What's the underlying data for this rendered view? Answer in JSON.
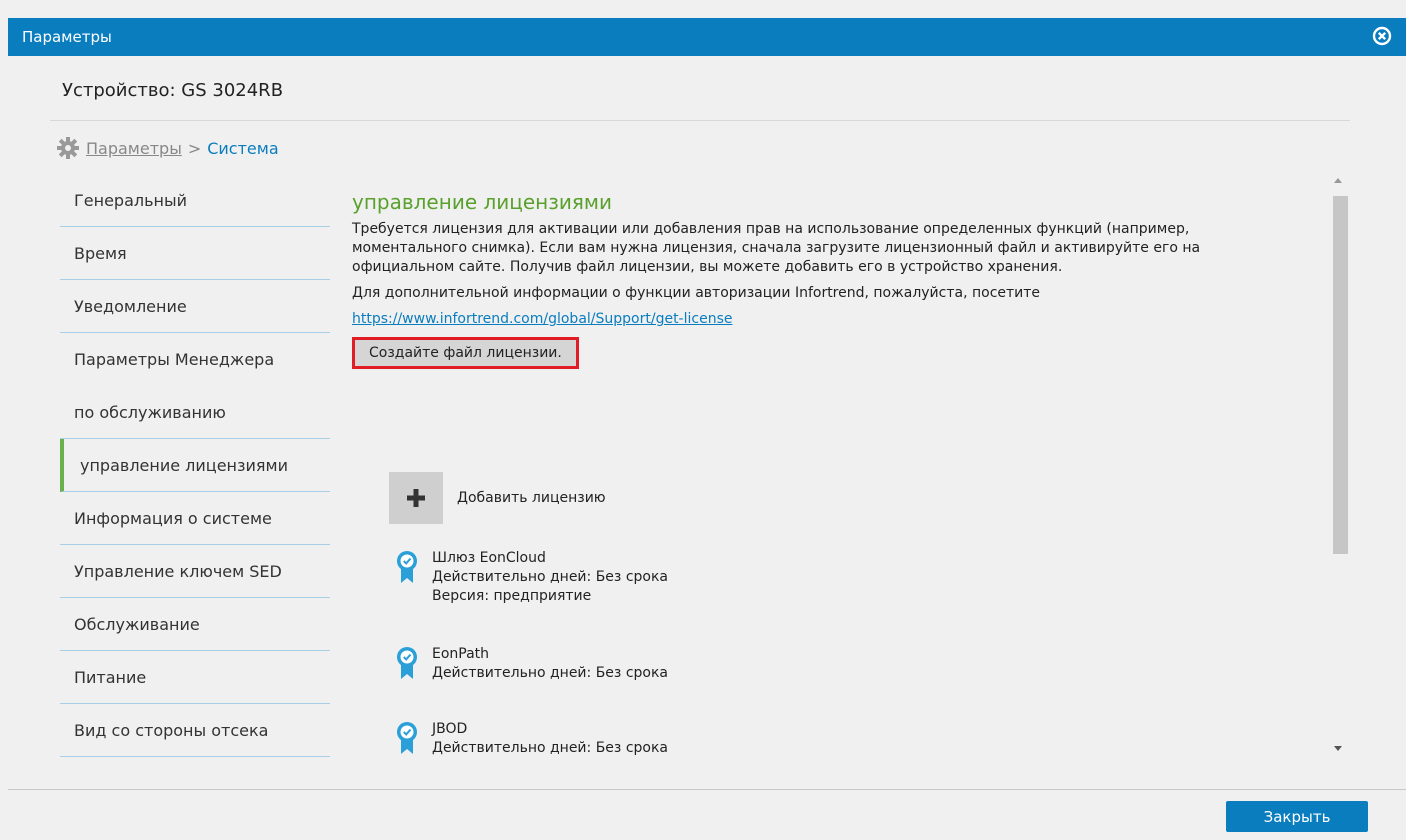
{
  "window": {
    "title": "Параметры"
  },
  "device_label": "Устройство: GS 3024RB",
  "breadcrumb": {
    "root": "Параметры",
    "separator": ">",
    "current": "Система"
  },
  "sidebar": {
    "items": [
      {
        "label": "Генеральный"
      },
      {
        "label": "Время"
      },
      {
        "label": "Уведомление"
      },
      {
        "label": "Параметры Менеджера"
      },
      {
        "label": "по обслуживанию"
      },
      {
        "label": "управление лицензиями",
        "active": true
      },
      {
        "label": "Информация о системе"
      },
      {
        "label": "Управление ключем SED"
      },
      {
        "label": "Обслуживание"
      },
      {
        "label": "Питание"
      },
      {
        "label": "Вид со стороны отсека"
      }
    ]
  },
  "main": {
    "heading": "управление лицензиями",
    "description": "Требуется лицензия для активации или добавления прав на использование определенных функций (например, моментального снимка). Если вам нужна лицензия, сначала загрузите лицензионный файл и активируйте его на официальном сайте. Получив файл лицензии, вы можете добавить его в устройство хранения.",
    "info": "Для дополнительной информации о функции авторизации Infortrend, пожалуйста, посетите",
    "link": "https://www.infortrend.com/global/Support/get-license",
    "generate_button": "Создайте файл лицензии.",
    "add_license": "Добавить лицензию",
    "licenses": [
      {
        "name": "Шлюз EonCloud",
        "validity": "Действительно дней: Без срока",
        "version": "Версия: предприятие"
      },
      {
        "name": "EonPath",
        "validity": "Действительно дней: Без срока"
      },
      {
        "name": "JBOD",
        "validity": "Действительно дней: Без срока"
      }
    ]
  },
  "footer": {
    "close_button": "Закрыть"
  },
  "colors": {
    "accent": "#0a7dbf",
    "heading": "#5aa02c",
    "highlight_border": "#e21c24",
    "badge": "#2a9fd8"
  }
}
